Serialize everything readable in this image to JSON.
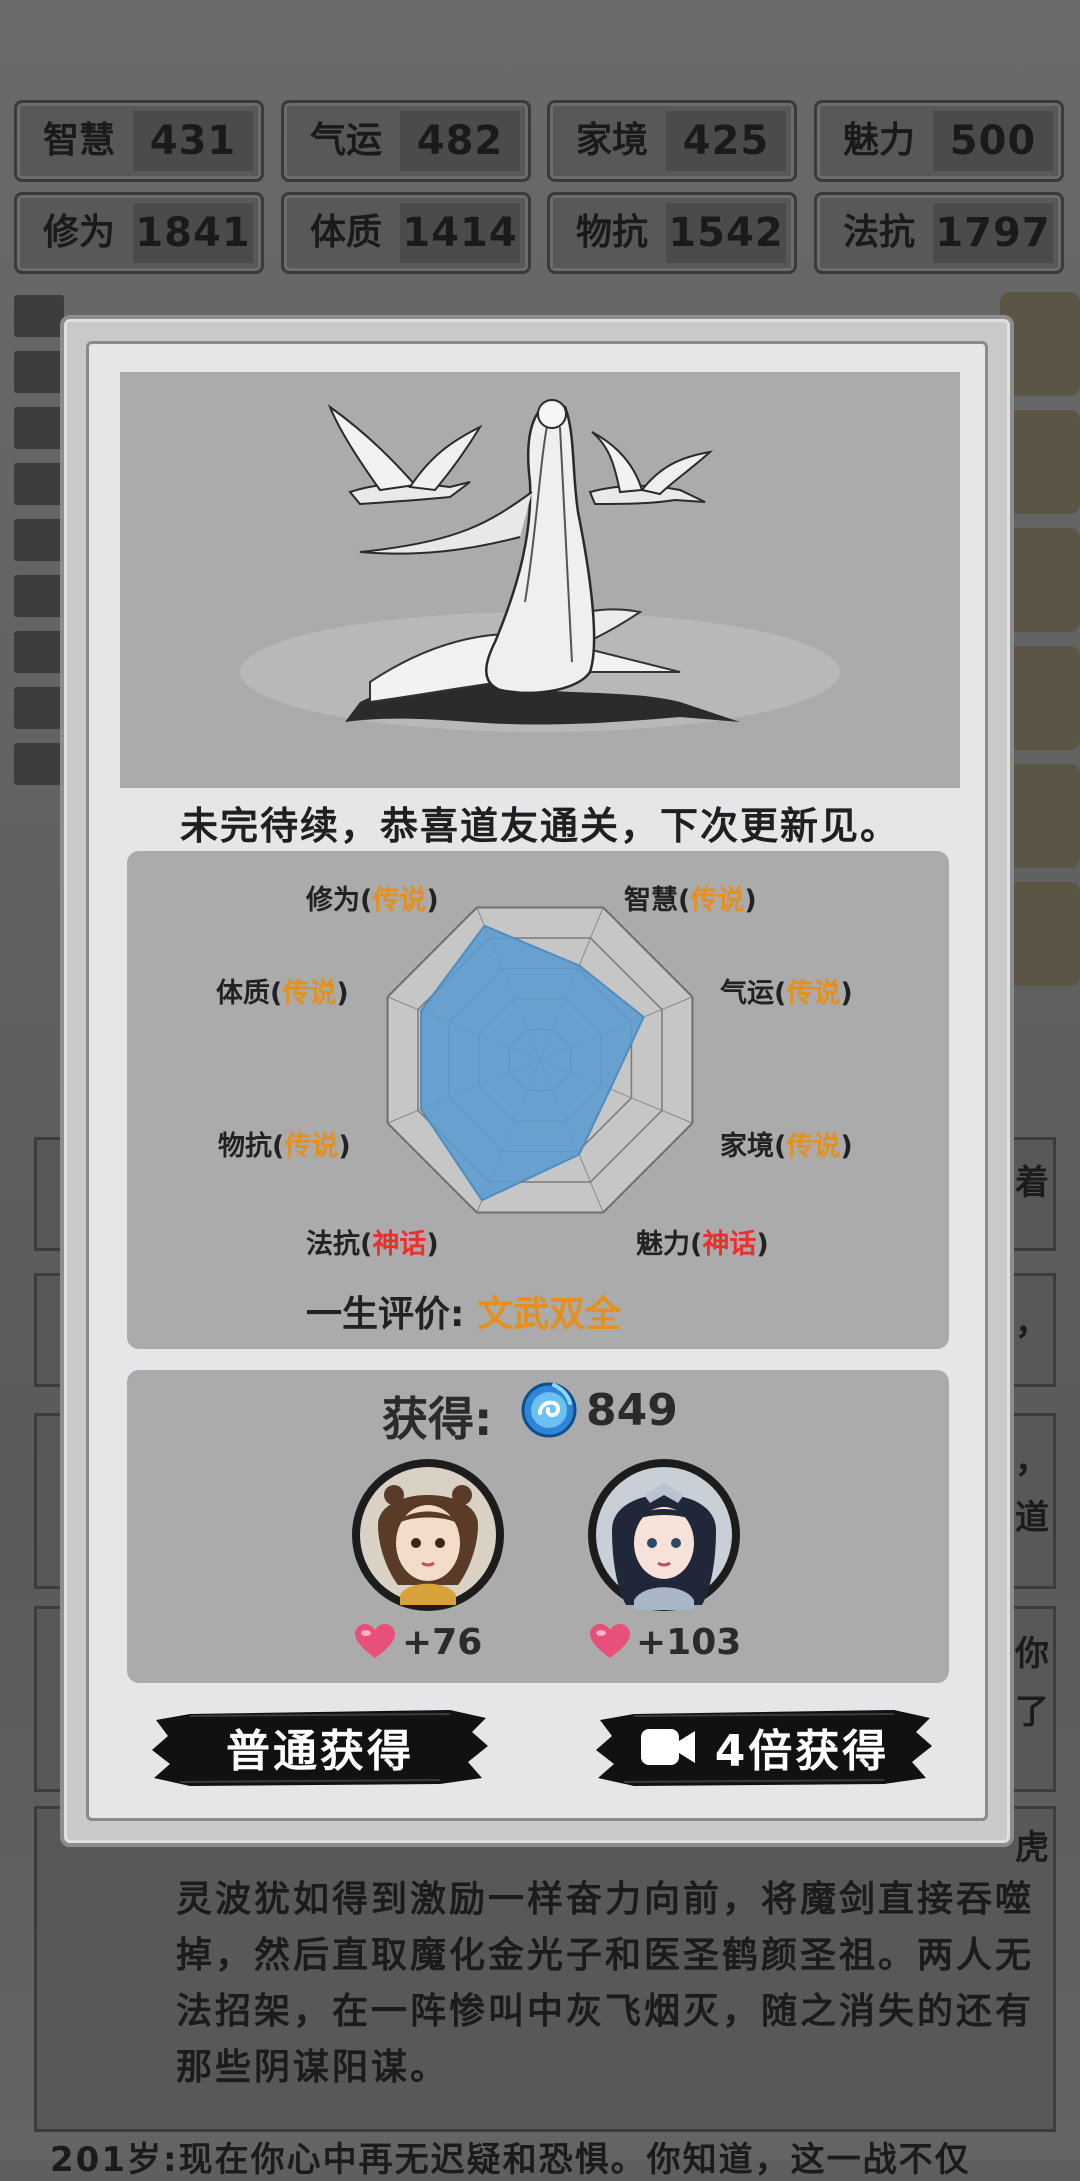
{
  "stats": [
    {
      "label": "智慧",
      "value": "431"
    },
    {
      "label": "气运",
      "value": "482"
    },
    {
      "label": "家境",
      "value": "425"
    },
    {
      "label": "魅力",
      "value": "500"
    },
    {
      "label": "修为",
      "value": "1841"
    },
    {
      "label": "体质",
      "value": "1414"
    },
    {
      "label": "物抗",
      "value": "1542"
    },
    {
      "label": "法抗",
      "value": "1797"
    }
  ],
  "background_text": {
    "story_lines": [
      "灵波犹如得到激励一样奋力向前，将魔剑直接吞噬",
      "掉，然后直取魔化金光子和医圣鹤颜圣祖。两人无",
      "法招架，在一阵惨叫中灰飞烟灭，随之消失的还有",
      "那些阴谋阳谋。"
    ],
    "bottom_line": "201岁:现在你心中再无迟疑和恐惧。你知道，这一战不仅",
    "right_chars": [
      "着",
      "，",
      "，",
      "道",
      "你",
      "了",
      "虎"
    ]
  },
  "modal": {
    "message": "未完待续，恭喜道友通关，下次更新见。",
    "radar": {
      "labels": [
        {
          "name": "修为",
          "level": "传说",
          "tier": "legend"
        },
        {
          "name": "智慧",
          "level": "传说",
          "tier": "legend"
        },
        {
          "name": "气运",
          "level": "传说",
          "tier": "legend"
        },
        {
          "name": "家境",
          "level": "传说",
          "tier": "legend"
        },
        {
          "name": "魅力",
          "level": "神话",
          "tier": "myth"
        },
        {
          "name": "法抗",
          "level": "神话",
          "tier": "myth"
        },
        {
          "name": "物抗",
          "level": "传说",
          "tier": "legend"
        },
        {
          "name": "体质",
          "level": "传说",
          "tier": "legend"
        }
      ],
      "values": [
        0.88,
        0.62,
        0.68,
        0.46,
        0.62,
        0.92,
        0.78,
        0.78
      ],
      "fill_color": "#5b9bd0"
    },
    "evaluation_label": "一生评价:",
    "evaluation_value": "文武双全",
    "reward": {
      "label": "获得:",
      "amount": "849",
      "companions": [
        {
          "affection": "+76"
        },
        {
          "affection": "+103"
        }
      ]
    },
    "buttons": {
      "normal": "普通获得",
      "video": "4倍获得"
    }
  }
}
